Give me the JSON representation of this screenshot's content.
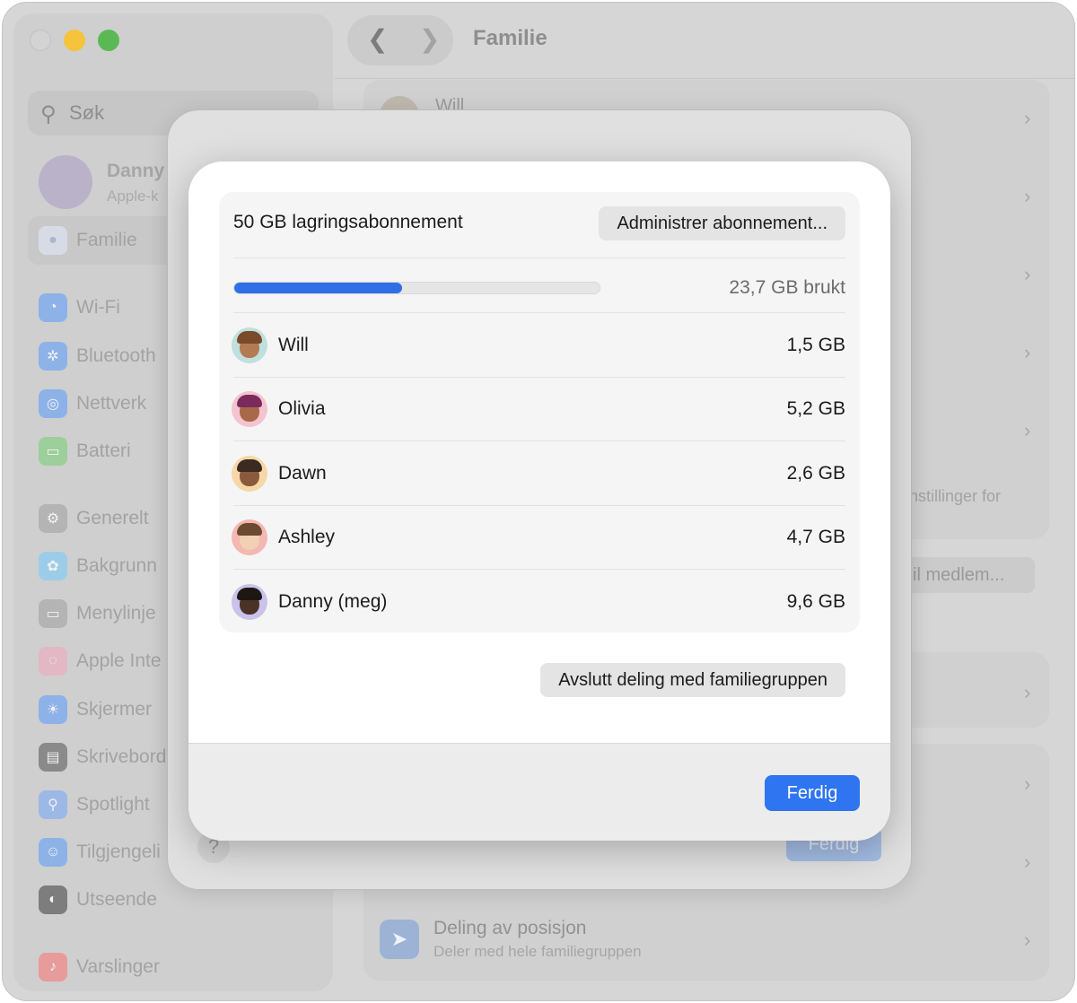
{
  "window": {
    "title": "Familie",
    "search_placeholder": "Søk",
    "account": {
      "name": "Danny",
      "subtitle": "Apple-k"
    },
    "sidebar": {
      "selected": "Familie",
      "items": [
        {
          "label": "Wi-Fi",
          "icon": "wifi-icon",
          "color": "#8db2e8"
        },
        {
          "label": "Bluetooth",
          "icon": "bluetooth-icon",
          "color": "#8db2e8"
        },
        {
          "label": "Nettverk",
          "icon": "globe-icon",
          "color": "#8db2e8"
        },
        {
          "label": "Batteri",
          "icon": "battery-icon",
          "color": "#9ccf9a"
        },
        {
          "label": "Generelt",
          "icon": "gear-icon",
          "color": "#b4b4b4"
        },
        {
          "label": "Bakgrunn",
          "icon": "flower-icon",
          "color": "#9ccde8"
        },
        {
          "label": "Menylinje",
          "icon": "menubar-icon",
          "color": "#b4b4b4"
        },
        {
          "label": "Apple Inte",
          "icon": "apple-intelligence-icon",
          "color": "#e3b7c4"
        },
        {
          "label": "Skjermer",
          "icon": "sun-icon",
          "color": "#8db2e8"
        },
        {
          "label": "Skrivebord",
          "icon": "desktop-icon",
          "color": "#8a8a8a"
        },
        {
          "label": "Spotlight",
          "icon": "magnifier-icon",
          "color": "#9cb8e6"
        },
        {
          "label": "Tilgjengeli",
          "icon": "accessibility-icon",
          "color": "#8db2e8"
        },
        {
          "label": "Utseende",
          "icon": "appearance-icon",
          "color": "#7d7d7d"
        },
        {
          "label": "Varslinger",
          "icon": "bell-icon",
          "color": "#e89b9b"
        }
      ]
    },
    "peek": {
      "member_name": "Will",
      "settings_text": "nstillinger for",
      "add_member_label": "il medlem...",
      "location_title": "Deling av posisjon",
      "location_subtitle": "Deler med hele familiegruppen",
      "mid_done_label": "Ferdig",
      "help_label": "?"
    }
  },
  "dialog": {
    "plan_label": "50 GB lagringsabonnement",
    "manage_button": "Administrer abonnement...",
    "usage_fraction": 0.46,
    "usage_text": "23,7 GB brukt",
    "accent_color": "#2f6fe6",
    "members": [
      {
        "name": "Will",
        "size": "1,5 GB",
        "bg": "#bfe0dc",
        "skin": "#b37a54",
        "hair": "#7a4a2b"
      },
      {
        "name": "Olivia",
        "size": "5,2 GB",
        "bg": "#f3c4d0",
        "skin": "#a8684a",
        "hair": "#7b2a5e"
      },
      {
        "name": "Dawn",
        "size": "2,6 GB",
        "bg": "#f6d8a8",
        "skin": "#8a5a3c",
        "hair": "#3a2a22"
      },
      {
        "name": "Ashley",
        "size": "4,7 GB",
        "bg": "#f4b7b2",
        "skin": "#f1d0b4",
        "hair": "#6b4a32"
      },
      {
        "name": "Danny (meg)",
        "size": "9,6 GB",
        "bg": "#c9c2ea",
        "skin": "#4a3326",
        "hair": "#1e1612"
      }
    ],
    "leave_button": "Avslutt deling med familiegruppen",
    "done_button": "Ferdig"
  }
}
